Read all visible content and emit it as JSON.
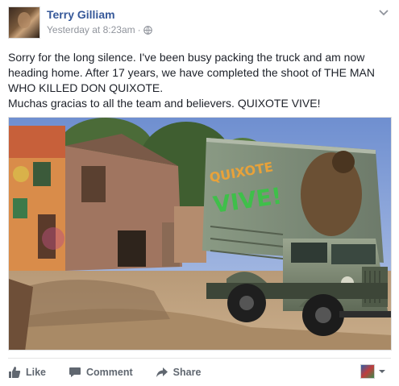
{
  "post": {
    "author": "Terry Gilliam",
    "timestamp": "Yesterday at 8:23am",
    "separator": "·",
    "privacy_icon": "globe-icon",
    "text_line1": "Sorry for the long silence. I've been busy packing the truck and am now heading home. After 17 years, we have completed the shoot of THE MAN WHO KILLED DON QUIXOTE.",
    "text_line2": "Muchas gracias to all the team and believers. QUIXOTE VIVE!"
  },
  "photo": {
    "truck_graffiti_line1": "QUIXOTE",
    "truck_graffiti_line2": "VIVE!"
  },
  "actions": {
    "like": "Like",
    "comment": "Comment",
    "share": "Share"
  },
  "colors": {
    "link_blue": "#365899",
    "text": "#1d2129",
    "meta_gray": "#90949c",
    "action_gray": "#606770"
  }
}
